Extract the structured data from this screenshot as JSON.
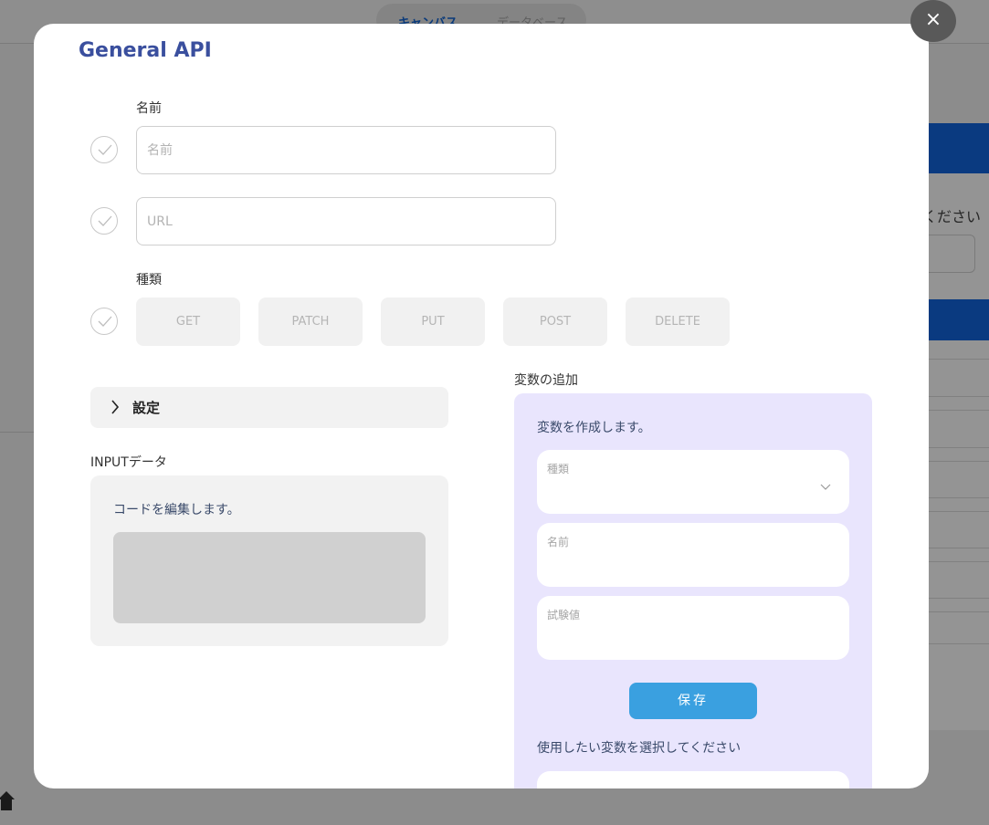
{
  "background": {
    "tabs": [
      "キャンバス",
      "データベース"
    ],
    "side_text": "ください"
  },
  "modal": {
    "title": "General API",
    "close_label": "×",
    "name": {
      "label": "名前",
      "placeholder": "名前"
    },
    "url": {
      "placeholder": "URL"
    },
    "type": {
      "label": "種類",
      "methods": [
        "GET",
        "PATCH",
        "PUT",
        "POST",
        "DELETE"
      ]
    },
    "settings": {
      "label": "設定"
    },
    "input_data": {
      "label": "INPUTデータ",
      "hint": "コードを編集します。"
    },
    "variables": {
      "label": "変数の追加",
      "hint": "変数を作成します。",
      "fields": [
        {
          "label": "種類"
        },
        {
          "label": "名前"
        },
        {
          "label": "試験値"
        }
      ],
      "save_label": "保存",
      "select_hint": "使用したい変数を選択してください"
    }
  },
  "colors": {
    "title": "#3a4f9e",
    "variables_panel": "#e9e5fd",
    "save_button": "#3aa0e0"
  }
}
